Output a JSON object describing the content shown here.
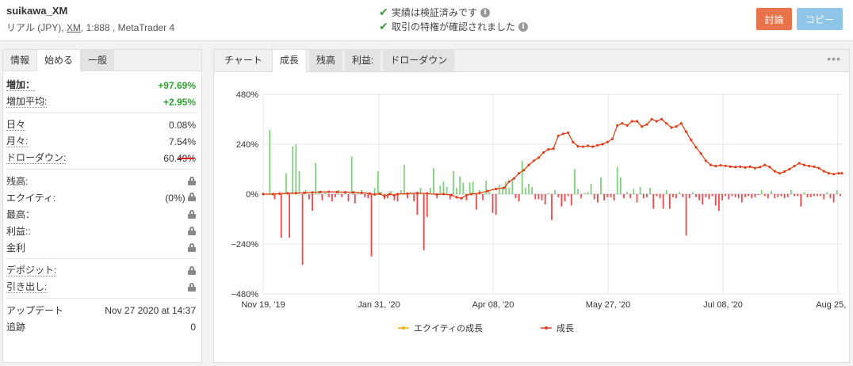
{
  "header": {
    "account_name": "suikawa_XM",
    "account_type": "リアル (JPY),",
    "broker": "XM",
    "account_rest": ", 1:888 , MetaTrader 4",
    "verify1": "実績は検証済みです",
    "verify2": "取引の特権が確認されました",
    "discuss_label": "討論",
    "copy_label": "コピー"
  },
  "left_tabs": [
    "情報",
    "始める",
    "一般"
  ],
  "stats": {
    "gain_label": "増加：",
    "gain_value": "+97.69%",
    "abs_gain_label": "増加平均:",
    "abs_gain_value": "+2.95%",
    "daily_label": "日々",
    "daily_value": "0.08%",
    "monthly_label": "月々:",
    "monthly_value": "7.54%",
    "drawdown_label": "ドローダウン:",
    "drawdown_value": "60.49%",
    "balance_label": "残高:",
    "equity_label": "エクイティ:",
    "equity_value": "(0%)",
    "highest_label": "最高：",
    "profit_label": "利益::",
    "interest_label": "金利",
    "deposits_label": "デポジット:",
    "withdrawals_label": "引き出し:",
    "updated_label": "アップデート",
    "updated_value": "Nov 27 2020 at 14:37",
    "tracking_label": "追跡",
    "tracking_value": "0"
  },
  "right_tabs": [
    "チャート",
    "成長",
    "残高",
    "利益:",
    "ドローダウン"
  ],
  "more_icon": "•••",
  "chart_data": {
    "type": "line",
    "y_ticks": [
      "480%",
      "240%",
      "0%",
      "−240%",
      "−480%"
    ],
    "x_ticks": [
      "Nov 19, '19",
      "Jan 31, '20",
      "Apr 08, '20",
      "May 27, '20",
      "Jul 08, '20",
      "Aug 25, '20"
    ],
    "ylim": [
      -480,
      480
    ],
    "series": [
      {
        "name": "エクイティの成長",
        "color": "#f0b000"
      },
      {
        "name": "成長",
        "color": "#e04020"
      }
    ],
    "growth_points": [
      [
        0,
        0
      ],
      [
        6,
        0
      ],
      [
        10,
        2
      ],
      [
        15,
        4
      ],
      [
        20,
        5
      ],
      [
        25,
        6
      ],
      [
        30,
        8
      ],
      [
        35,
        10
      ],
      [
        40,
        11
      ],
      [
        45,
        10
      ],
      [
        50,
        9
      ],
      [
        55,
        8
      ],
      [
        60,
        6
      ],
      [
        65,
        3
      ],
      [
        68,
        -2
      ],
      [
        71,
        2
      ],
      [
        74,
        -10
      ],
      [
        77,
        0
      ],
      [
        80,
        -6
      ],
      [
        82,
        0
      ],
      [
        88,
        2
      ],
      [
        94,
        5
      ],
      [
        100,
        3
      ],
      [
        106,
        -2
      ],
      [
        110,
        0
      ],
      [
        115,
        -5
      ],
      [
        118,
        -15
      ],
      [
        121,
        -20
      ],
      [
        124,
        -5
      ],
      [
        127,
        0
      ],
      [
        132,
        5
      ],
      [
        137,
        15
      ],
      [
        142,
        25
      ],
      [
        147,
        30
      ],
      [
        150,
        60
      ],
      [
        153,
        75
      ],
      [
        156,
        100
      ],
      [
        159,
        115
      ],
      [
        162,
        140
      ],
      [
        165,
        160
      ],
      [
        168,
        175
      ],
      [
        171,
        200
      ],
      [
        174,
        215
      ],
      [
        177,
        218
      ],
      [
        180,
        280
      ],
      [
        183,
        290
      ],
      [
        186,
        295
      ],
      [
        189,
        250
      ],
      [
        192,
        230
      ],
      [
        195,
        228
      ],
      [
        198,
        232
      ],
      [
        201,
        228
      ],
      [
        204,
        235
      ],
      [
        207,
        240
      ],
      [
        210,
        250
      ],
      [
        213,
        265
      ],
      [
        216,
        330
      ],
      [
        219,
        340
      ],
      [
        222,
        330
      ],
      [
        225,
        350
      ],
      [
        228,
        350
      ],
      [
        231,
        325
      ],
      [
        234,
        335
      ],
      [
        237,
        360
      ],
      [
        240,
        350
      ],
      [
        243,
        360
      ],
      [
        246,
        340
      ],
      [
        249,
        320
      ],
      [
        252,
        325
      ],
      [
        255,
        340
      ],
      [
        258,
        300
      ],
      [
        261,
        260
      ],
      [
        264,
        225
      ],
      [
        267,
        195
      ],
      [
        270,
        160
      ],
      [
        273,
        140
      ],
      [
        276,
        135
      ],
      [
        279,
        138
      ],
      [
        282,
        136
      ],
      [
        285,
        132
      ],
      [
        288,
        130
      ],
      [
        291,
        132
      ],
      [
        294,
        128
      ],
      [
        297,
        132
      ],
      [
        300,
        125
      ],
      [
        303,
        130
      ],
      [
        306,
        140
      ],
      [
        309,
        130
      ],
      [
        312,
        110
      ],
      [
        315,
        100
      ],
      [
        318,
        108
      ],
      [
        321,
        120
      ],
      [
        324,
        135
      ],
      [
        327,
        148
      ],
      [
        330,
        140
      ],
      [
        333,
        135
      ],
      [
        336,
        132
      ],
      [
        339,
        125
      ],
      [
        342,
        110
      ],
      [
        345,
        100
      ],
      [
        348,
        96
      ],
      [
        351,
        100
      ],
      [
        353,
        100
      ]
    ],
    "bars": [
      [
        4,
        310
      ],
      [
        7,
        -25
      ],
      [
        11,
        -210
      ],
      [
        14,
        100
      ],
      [
        16,
        -210
      ],
      [
        18,
        230
      ],
      [
        20,
        240
      ],
      [
        22,
        110
      ],
      [
        24,
        -340
      ],
      [
        26,
        20
      ],
      [
        28,
        -25
      ],
      [
        30,
        -80
      ],
      [
        32,
        150
      ],
      [
        34,
        15
      ],
      [
        36,
        -30
      ],
      [
        38,
        10
      ],
      [
        40,
        -15
      ],
      [
        42,
        -35
      ],
      [
        44,
        -15
      ],
      [
        46,
        20
      ],
      [
        48,
        -15
      ],
      [
        50,
        10
      ],
      [
        52,
        -35
      ],
      [
        54,
        180
      ],
      [
        56,
        -45
      ],
      [
        58,
        10
      ],
      [
        60,
        20
      ],
      [
        62,
        -15
      ],
      [
        64,
        -20
      ],
      [
        66,
        -300
      ],
      [
        68,
        30
      ],
      [
        70,
        110
      ],
      [
        72,
        10
      ],
      [
        74,
        -25
      ],
      [
        76,
        -20
      ],
      [
        78,
        15
      ],
      [
        80,
        -30
      ],
      [
        82,
        -35
      ],
      [
        84,
        20
      ],
      [
        86,
        140
      ],
      [
        88,
        -20
      ],
      [
        90,
        10
      ],
      [
        92,
        -35
      ],
      [
        94,
        -100
      ],
      [
        96,
        30
      ],
      [
        98,
        -270
      ],
      [
        100,
        -110
      ],
      [
        102,
        30
      ],
      [
        104,
        125
      ],
      [
        106,
        -20
      ],
      [
        108,
        40
      ],
      [
        110,
        60
      ],
      [
        112,
        35
      ],
      [
        114,
        -25
      ],
      [
        116,
        110
      ],
      [
        118,
        30
      ],
      [
        120,
        85
      ],
      [
        122,
        55
      ],
      [
        124,
        -30
      ],
      [
        126,
        55
      ],
      [
        128,
        60
      ],
      [
        130,
        -75
      ],
      [
        132,
        20
      ],
      [
        134,
        -30
      ],
      [
        136,
        65
      ],
      [
        138,
        10
      ],
      [
        140,
        -90
      ],
      [
        142,
        -100
      ],
      [
        144,
        45
      ],
      [
        146,
        35
      ],
      [
        148,
        60
      ],
      [
        150,
        30
      ],
      [
        152,
        75
      ],
      [
        154,
        -20
      ],
      [
        156,
        -35
      ],
      [
        158,
        160
      ],
      [
        160,
        30
      ],
      [
        162,
        50
      ],
      [
        164,
        35
      ],
      [
        166,
        -25
      ],
      [
        168,
        -25
      ],
      [
        170,
        -30
      ],
      [
        172,
        -50
      ],
      [
        174,
        5
      ],
      [
        176,
        -125
      ],
      [
        178,
        20
      ],
      [
        180,
        -15
      ],
      [
        182,
        -60
      ],
      [
        184,
        -35
      ],
      [
        186,
        -10
      ],
      [
        188,
        -55
      ],
      [
        190,
        120
      ],
      [
        192,
        25
      ],
      [
        194,
        -20
      ],
      [
        196,
        5
      ],
      [
        198,
        10
      ],
      [
        200,
        50
      ],
      [
        202,
        -25
      ],
      [
        204,
        -40
      ],
      [
        206,
        80
      ],
      [
        208,
        -30
      ],
      [
        210,
        -15
      ],
      [
        212,
        -15
      ],
      [
        214,
        -30
      ],
      [
        216,
        130
      ],
      [
        218,
        80
      ],
      [
        220,
        -20
      ],
      [
        222,
        10
      ],
      [
        224,
        -20
      ],
      [
        226,
        25
      ],
      [
        228,
        -40
      ],
      [
        230,
        35
      ],
      [
        232,
        -20
      ],
      [
        234,
        -15
      ],
      [
        236,
        30
      ],
      [
        238,
        -70
      ],
      [
        240,
        -10
      ],
      [
        242,
        -20
      ],
      [
        244,
        -70
      ],
      [
        246,
        20
      ],
      [
        248,
        -70
      ],
      [
        250,
        -15
      ],
      [
        252,
        -20
      ],
      [
        254,
        10
      ],
      [
        256,
        -15
      ],
      [
        258,
        -200
      ],
      [
        260,
        -20
      ],
      [
        262,
        10
      ],
      [
        264,
        -15
      ],
      [
        266,
        -30
      ],
      [
        268,
        -50
      ],
      [
        270,
        -15
      ],
      [
        272,
        -25
      ],
      [
        274,
        -10
      ],
      [
        276,
        -55
      ],
      [
        278,
        -80
      ],
      [
        280,
        -30
      ],
      [
        282,
        -10
      ],
      [
        284,
        -25
      ],
      [
        286,
        -10
      ],
      [
        288,
        -15
      ],
      [
        290,
        -20
      ],
      [
        292,
        -40
      ],
      [
        294,
        -15
      ],
      [
        296,
        -10
      ],
      [
        298,
        -20
      ],
      [
        300,
        -15
      ],
      [
        302,
        -5
      ],
      [
        304,
        20
      ],
      [
        306,
        -10
      ],
      [
        308,
        -20
      ],
      [
        310,
        15
      ],
      [
        312,
        -20
      ],
      [
        314,
        -15
      ],
      [
        316,
        -10
      ],
      [
        318,
        -20
      ],
      [
        320,
        -15
      ],
      [
        322,
        20
      ],
      [
        324,
        -10
      ],
      [
        326,
        -10
      ],
      [
        328,
        -60
      ],
      [
        330,
        10
      ],
      [
        332,
        -15
      ],
      [
        334,
        -15
      ],
      [
        336,
        -10
      ],
      [
        338,
        -10
      ],
      [
        340,
        -10
      ],
      [
        342,
        -25
      ],
      [
        344,
        10
      ],
      [
        346,
        -20
      ],
      [
        348,
        -40
      ],
      [
        350,
        20
      ],
      [
        352,
        -10
      ]
    ],
    "x_range": [
      0,
      353
    ]
  }
}
